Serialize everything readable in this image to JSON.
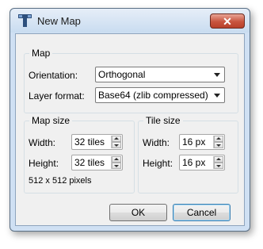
{
  "window": {
    "title": "New Map",
    "close_glyph": "✕"
  },
  "map_group": {
    "title": "Map",
    "orientation_label": "Orientation:",
    "orientation_value": "Orthogonal",
    "layer_format_label": "Layer format:",
    "layer_format_value": "Base64 (zlib compressed)"
  },
  "map_size_group": {
    "title": "Map size",
    "width_label": "Width:",
    "width_value": "32 tiles",
    "height_label": "Height:",
    "height_value": "32 tiles",
    "pixel_info": "512 x 512 pixels"
  },
  "tile_size_group": {
    "title": "Tile size",
    "width_label": "Width:",
    "width_value": "16 px",
    "height_label": "Height:",
    "height_value": "16 px"
  },
  "buttons": {
    "ok": "OK",
    "cancel": "Cancel"
  },
  "colors": {
    "window_frame": "#cfe0f3",
    "close_button": "#c8543e",
    "dialog_body": "#f0f0f0",
    "default_button_border": "#3c7fb1"
  },
  "icons": {
    "app": "tiled-app-icon",
    "close": "close-icon",
    "dropdown": "chevron-down-icon",
    "spin_up": "spin-up-icon",
    "spin_down": "spin-down-icon"
  }
}
